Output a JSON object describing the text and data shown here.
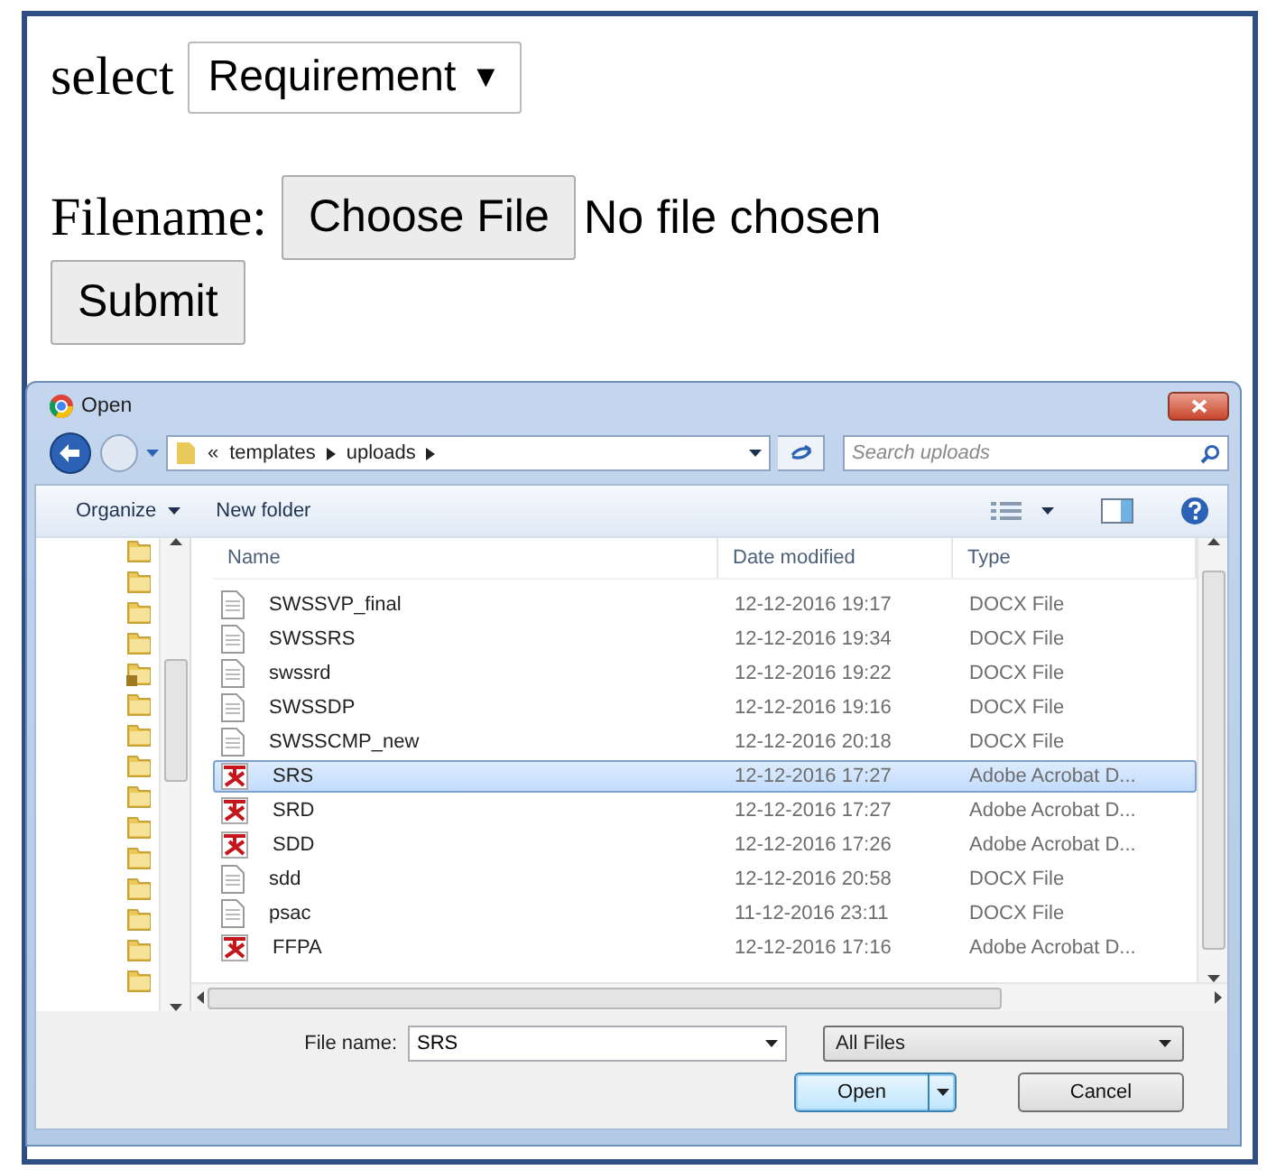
{
  "form": {
    "select_label": "select",
    "select": {
      "value": "Requirement",
      "arrow": "▼"
    },
    "file_label": "Filename:",
    "choose_button": "Choose File",
    "file_status": "No file chosen",
    "submit_button": "Submit"
  },
  "dialog": {
    "title": "Open",
    "breadcrumb": [
      "«",
      "templates",
      "uploads"
    ],
    "search": {
      "placeholder": "Search uploads"
    },
    "toolbar": {
      "organize": "Organize",
      "new_folder": "New folder"
    },
    "columns": [
      "Name",
      "Date modified",
      "Type"
    ],
    "files": [
      {
        "name": "SWSSVP_final",
        "date": "12-12-2016 19:17",
        "type": "DOCX File",
        "kind": "docx",
        "selected": false
      },
      {
        "name": "SWSSRS",
        "date": "12-12-2016 19:34",
        "type": "DOCX File",
        "kind": "docx",
        "selected": false
      },
      {
        "name": "swssrd",
        "date": "12-12-2016 19:22",
        "type": "DOCX File",
        "kind": "docx",
        "selected": false
      },
      {
        "name": "SWSSDP",
        "date": "12-12-2016 19:16",
        "type": "DOCX File",
        "kind": "docx",
        "selected": false
      },
      {
        "name": "SWSSCMP_new",
        "date": "12-12-2016 20:18",
        "type": "DOCX File",
        "kind": "docx",
        "selected": false
      },
      {
        "name": "SRS",
        "date": "12-12-2016 17:27",
        "type": "Adobe Acrobat D...",
        "kind": "pdf",
        "selected": true
      },
      {
        "name": "SRD",
        "date": "12-12-2016 17:27",
        "type": "Adobe Acrobat D...",
        "kind": "pdf",
        "selected": false
      },
      {
        "name": "SDD",
        "date": "12-12-2016 17:26",
        "type": "Adobe Acrobat D...",
        "kind": "pdf",
        "selected": false
      },
      {
        "name": "sdd",
        "date": "12-12-2016 20:58",
        "type": "DOCX File",
        "kind": "docx",
        "selected": false
      },
      {
        "name": "psac",
        "date": "11-12-2016 23:11",
        "type": "DOCX File",
        "kind": "docx",
        "selected": false
      },
      {
        "name": "FFPA",
        "date": "12-12-2016 17:16",
        "type": "Adobe Acrobat D...",
        "kind": "pdf",
        "selected": false
      }
    ],
    "file_name_label": "File name:",
    "file_name_value": "SRS",
    "filter": "All Files",
    "open_button": "Open",
    "cancel_button": "Cancel"
  }
}
